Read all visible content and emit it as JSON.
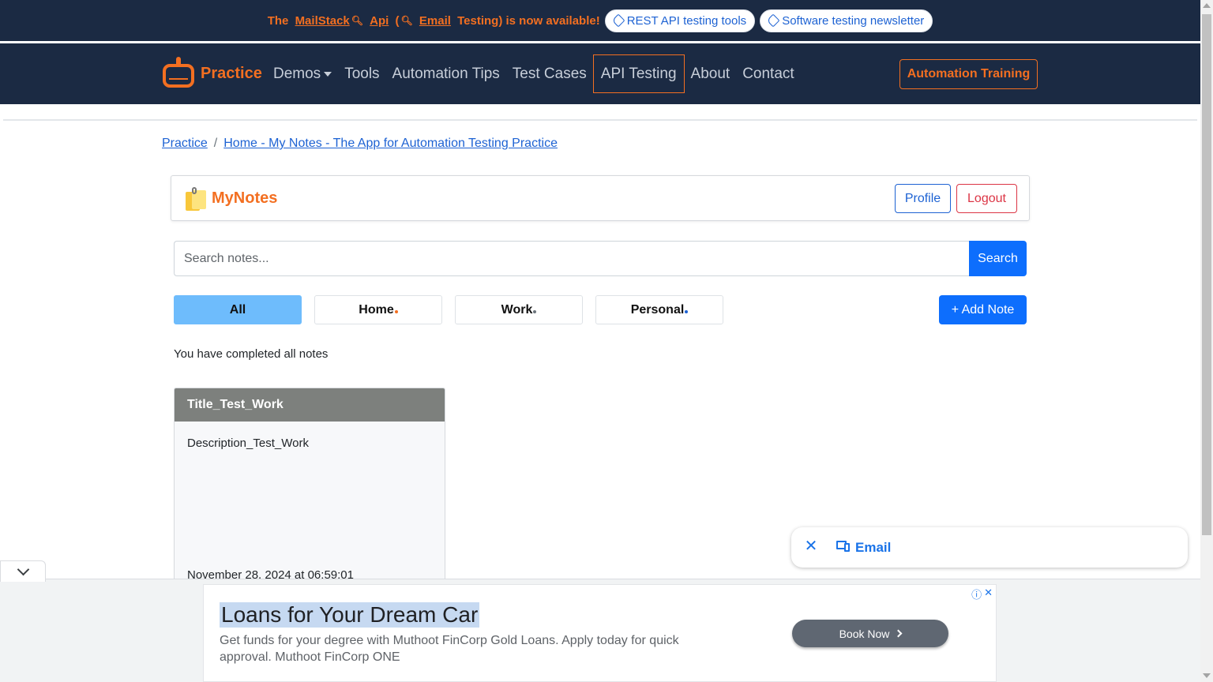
{
  "promo": {
    "prefix": "The",
    "mailstack": "MailStack",
    "api": "Api",
    "paren": "(",
    "email_testing": "Email",
    "suffix": "Testing) is now available!",
    "pills": [
      "REST API testing tools",
      "Software testing newsletter"
    ]
  },
  "nav": {
    "brand": "Practice",
    "links": [
      "Demos",
      "Tools",
      "Automation Tips",
      "Test Cases",
      "API Testing",
      "About",
      "Contact"
    ],
    "active": "API Testing",
    "training": "Automation Training"
  },
  "breadcrumb": {
    "items": [
      "Practice",
      "Home - My Notes - The App for Automation Testing Practice"
    ],
    "separator": "/"
  },
  "app": {
    "title": "MyNotes",
    "profile": "Profile",
    "logout": "Logout"
  },
  "search": {
    "placeholder": "Search notes...",
    "value": "",
    "button": "Search"
  },
  "categories": {
    "all": "All",
    "home": "Home",
    "work": "Work",
    "personal": "Personal",
    "selected": "All"
  },
  "add_note": "+ Add Note",
  "status_text": "You have completed all notes",
  "notes": [
    {
      "title": "Title_Test_Work",
      "description": "Description_Test_Work",
      "date": "November 28, 2024 at 06:59:01"
    }
  ],
  "email_popup": {
    "label": "Email"
  },
  "ad": {
    "title": "Loans for Your Dream Car",
    "body": "Get funds for your degree with Muthoot FinCorp Gold Loans. Apply today for quick approval. Muthoot FinCorp ONE",
    "cta": "Book Now"
  },
  "colors": {
    "navy": "#1b2a43",
    "orange": "#f36f21",
    "primary": "#0d6efd",
    "active_tab": "#6ebcfc",
    "note_header": "#7d807d",
    "home_dot": "#f36f21",
    "work_dot": "#6c757d",
    "personal_dot": "#1d62d3"
  }
}
